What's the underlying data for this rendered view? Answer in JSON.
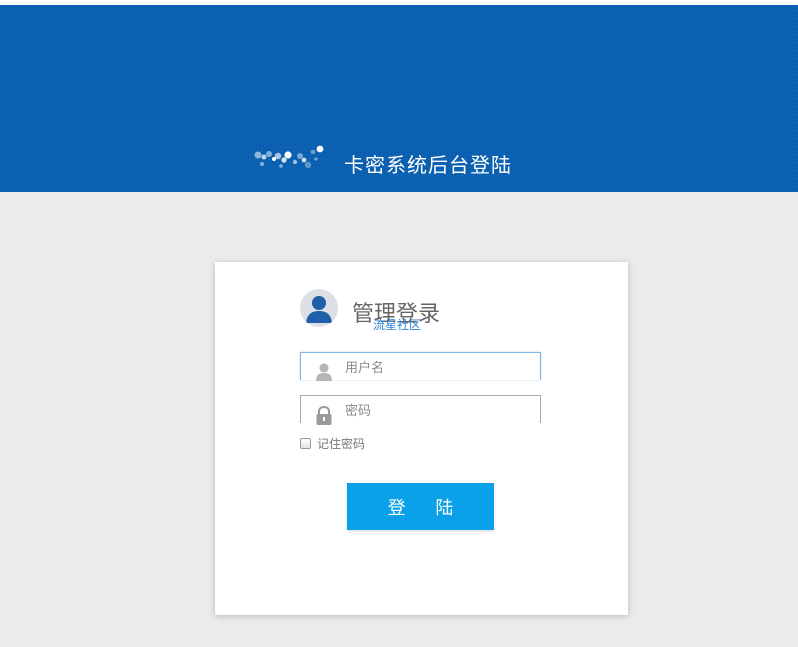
{
  "banner": {
    "title": "卡密系统后台登陆",
    "logo_icon": "dotted-cloud-logo-icon",
    "background_color": "#0a5fb0"
  },
  "login": {
    "title": "管理登录",
    "subtitle": "流星社区",
    "avatar_icon": "user-avatar-icon",
    "username": {
      "placeholder": "用户名",
      "value": "",
      "icon": "user-icon"
    },
    "password": {
      "placeholder": "密码",
      "value": "",
      "icon": "lock-icon"
    },
    "remember": {
      "label": "记住密码",
      "checked": false
    },
    "submit_label": "登 陆",
    "button_color": "#0aa1e8"
  }
}
